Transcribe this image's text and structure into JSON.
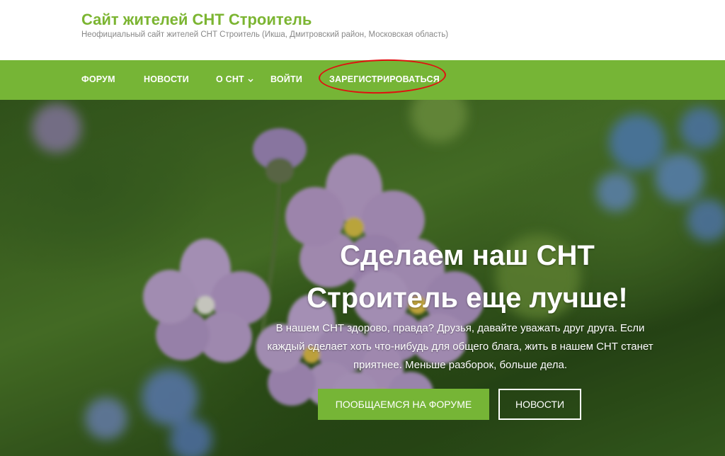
{
  "site": {
    "title": "Сайт жителей СНТ Строитель",
    "description": "Неофициальный сайт жителей СНТ Строитель (Икша, Дмитровский район, Московская область)"
  },
  "nav": {
    "items": [
      {
        "label": "ФОРУМ"
      },
      {
        "label": "НОВОСТИ"
      },
      {
        "label": "О СНТ",
        "has_dropdown": true
      },
      {
        "label": "ВОЙТИ"
      },
      {
        "label": "ЗАРЕГИСТРИРОВАТЬСЯ",
        "highlighted": true
      }
    ]
  },
  "hero": {
    "title_line1": "Сделаем наш СНТ",
    "title_line2": "Строитель еще лучше!",
    "text_line1": "В нашем СНТ здорово, правда? Друзья, давайте уважать друг друга. Если",
    "text_line2": "каждый сделает хоть что-нибудь для общего блага, жить в нашем СНТ станет",
    "text_line3": "приятнее. Меньше разборок, больше дела.",
    "primary_button": "ПООБЩАЕМСЯ НА ФОРУМЕ",
    "secondary_button": "НОВОСТИ"
  },
  "colors": {
    "brand_green": "#76b536",
    "title_green": "#7cb532",
    "annotation_red": "#e01010"
  }
}
